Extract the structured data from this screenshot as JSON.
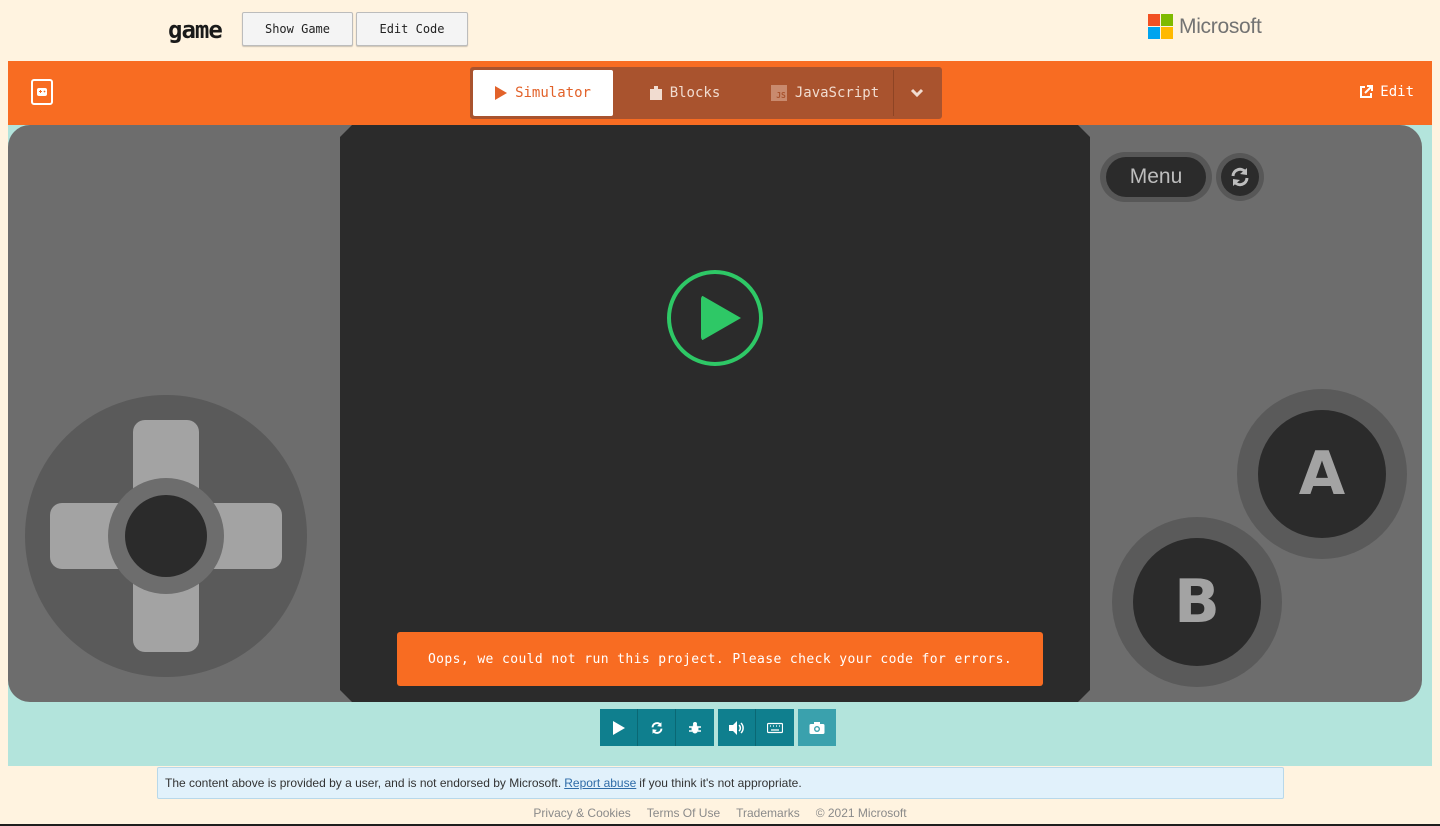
{
  "topbar": {
    "title": "game",
    "show_game_label": "Show Game",
    "edit_code_label": "Edit Code",
    "brand": "Microsoft"
  },
  "header": {
    "tabs": {
      "simulator": "Simulator",
      "blocks": "Blocks",
      "javascript": "JavaScript",
      "js_badge": "JS"
    },
    "edit_label": "Edit"
  },
  "simulator": {
    "error_message": "Oops, we could not run this project. Please check your code for errors.",
    "menu_label": "Menu",
    "a_label": "A",
    "b_label": "B"
  },
  "footer": {
    "disclaimer_pre": "The content above is provided by a user, and is not endorsed by Microsoft.",
    "report_link": "Report abuse",
    "disclaimer_post": "if you think it's not appropriate.",
    "links": {
      "privacy": "Privacy & Cookies",
      "terms": "Terms Of Use",
      "trademarks": "Trademarks",
      "copyright": "© 2021 Microsoft"
    }
  },
  "colors": {
    "accent_orange": "#f86c22",
    "play_green": "#2ec866",
    "toolbar_teal": "#0f7f8e",
    "background_mint": "#b3e4dc"
  }
}
